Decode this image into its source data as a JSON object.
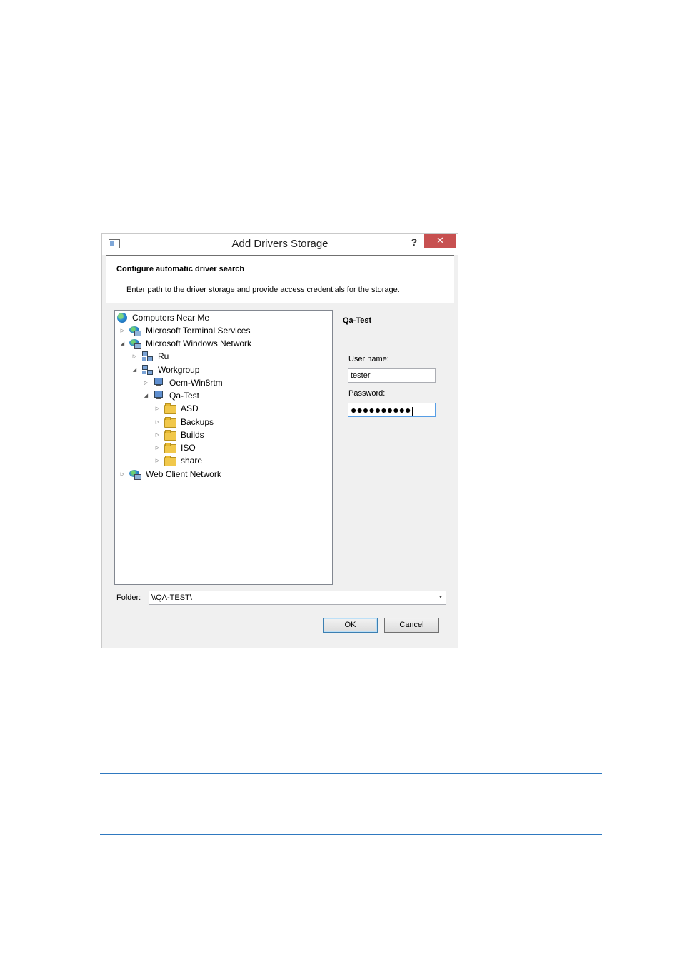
{
  "dialog": {
    "title": "Add Drivers Storage",
    "help_label": "?",
    "close_label": "✕"
  },
  "header": {
    "title": "Configure automatic driver search",
    "description": "Enter path to the driver storage and provide access credentials for the storage."
  },
  "tree": {
    "root": "Computers Near Me",
    "terminal_services": "Microsoft Terminal Services",
    "windows_network": "Microsoft Windows Network",
    "ru": "Ru",
    "workgroup": "Workgroup",
    "oem": "Oem-Win8rtm",
    "qa_test": "Qa-Test",
    "asd": "ASD",
    "backups": "Backups",
    "builds": "Builds",
    "iso": "ISO",
    "share": "share",
    "web_client": "Web Client Network"
  },
  "credentials": {
    "selected_name": "Qa-Test",
    "username_label": "User name:",
    "username_value": "tester",
    "password_label": "Password:",
    "password_value": "●●●●●●●●●●"
  },
  "folder": {
    "label": "Folder:",
    "value": "\\\\QA-TEST\\"
  },
  "buttons": {
    "ok": "OK",
    "cancel": "Cancel"
  }
}
